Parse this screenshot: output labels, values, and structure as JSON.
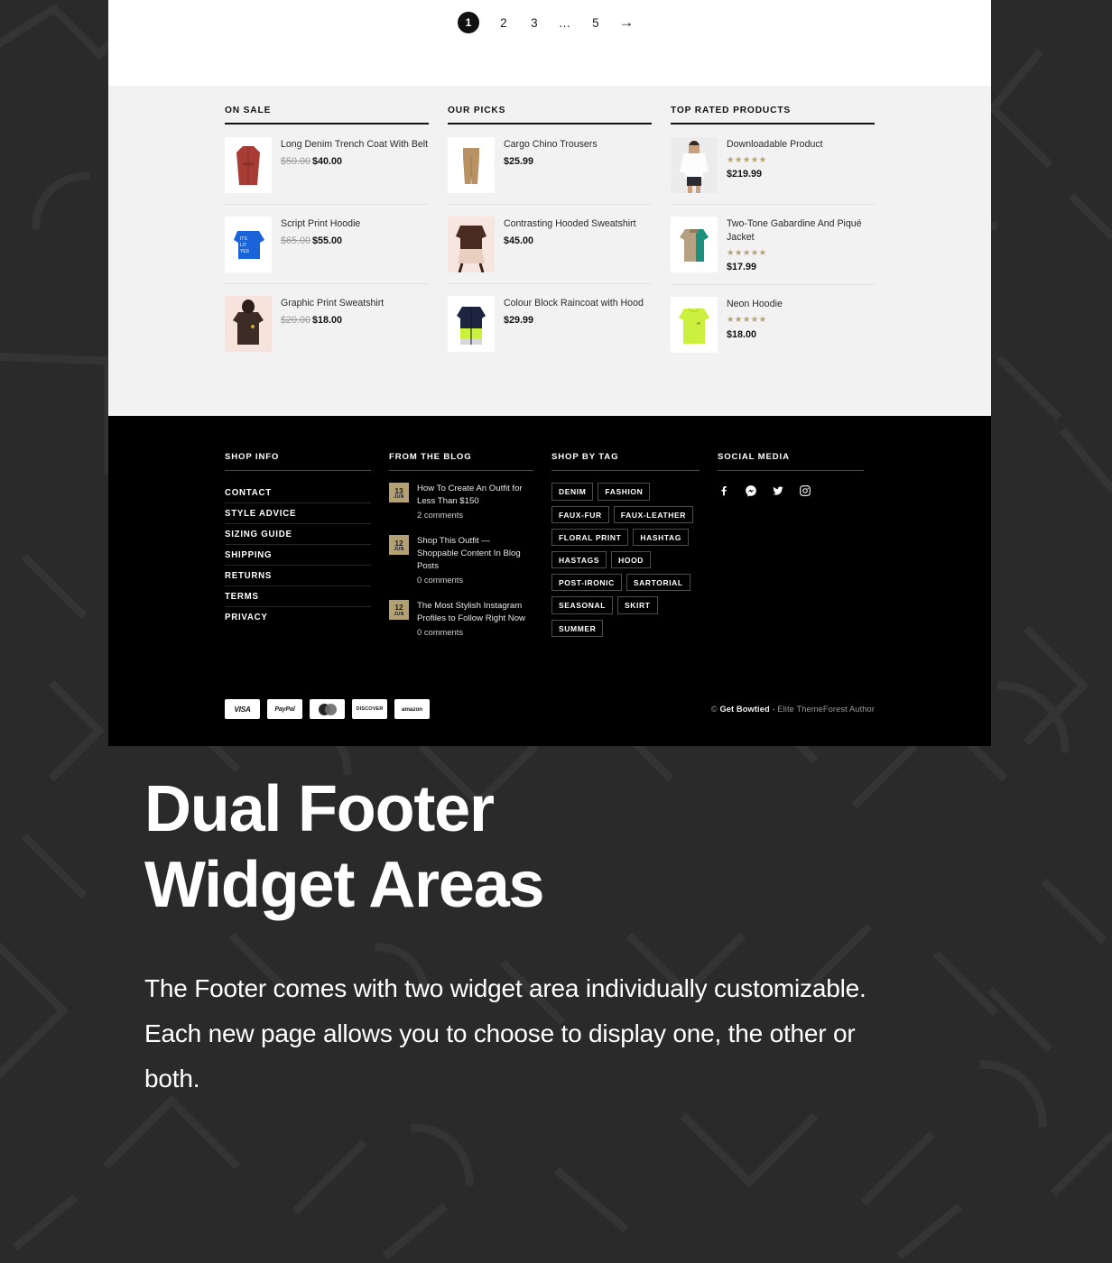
{
  "pagination": {
    "items": [
      {
        "label": "1",
        "active": true
      },
      {
        "label": "2",
        "active": false
      },
      {
        "label": "3",
        "active": false
      },
      {
        "label": "…",
        "active": false
      },
      {
        "label": "5",
        "active": false
      }
    ],
    "next_label": "→"
  },
  "widgets": [
    {
      "title": "ON SALE",
      "type": "sale",
      "products": [
        {
          "name": "Long Denim Trench Coat With Belt",
          "old_price": "$50.00",
          "price": "$40.00",
          "thumb": "trench-coat-red"
        },
        {
          "name": "Script Print Hoodie",
          "old_price": "$65.00",
          "price": "$55.00",
          "thumb": "hoodie-blue-print"
        },
        {
          "name": "Graphic Print Sweatshirt",
          "old_price": "$20.00",
          "price": "$18.00",
          "thumb": "sweatshirt-brown"
        }
      ]
    },
    {
      "title": "OUR PICKS",
      "type": "picks",
      "products": [
        {
          "name": "Cargo Chino Trousers",
          "price": "$25.99",
          "thumb": "chino-trousers-tan"
        },
        {
          "name": "Contrasting Hooded Sweatshirt",
          "price": "$45.00",
          "thumb": "hooded-sweatshirt-brown"
        },
        {
          "name": "Colour Block Raincoat with Hood",
          "price": "$29.99",
          "thumb": "raincoat-colourblock"
        }
      ]
    },
    {
      "title": "TOP RATED PRODUCTS",
      "type": "rated",
      "products": [
        {
          "name": "Downloadable Product",
          "rating": "★★★★★",
          "price": "$219.99",
          "thumb": "model-white-top"
        },
        {
          "name": "Two-Tone Gabardine And Piqué Jacket",
          "rating": "★★★★★",
          "price": "$17.99",
          "thumb": "jacket-two-tone"
        },
        {
          "name": "Neon Hoodie",
          "rating": "★★★★★",
          "price": "$18.00",
          "thumb": "hoodie-neon-green"
        }
      ]
    }
  ],
  "footer": {
    "shop_info": {
      "title": "SHOP INFO",
      "links": [
        "CONTACT",
        "STYLE ADVICE",
        "SIZING GUIDE",
        "SHIPPING",
        "RETURNS",
        "TERMS",
        "PRIVACY"
      ]
    },
    "blog": {
      "title": "FROM THE BLOG",
      "posts": [
        {
          "day": "13",
          "month": "JUN",
          "title": "How To Create An Outfit for Less Than $150",
          "comments": "2 comments"
        },
        {
          "day": "12",
          "month": "JUN",
          "title": "Shop This Outfit — Shoppable Content In Blog Posts",
          "comments": "0 comments"
        },
        {
          "day": "12",
          "month": "JUN",
          "title": "The Most Stylish Instagram Profiles to Follow Right Now",
          "comments": "0 comments"
        }
      ]
    },
    "tags": {
      "title": "SHOP BY TAG",
      "items": [
        "DENIM",
        "FASHION",
        "FAUX-FUR",
        "FAUX-LEATHER",
        "FLORAL PRINT",
        "HASHTAG",
        "HASTAGS",
        "HOOD",
        "POST-IRONIC",
        "SARTORIAL",
        "SEASONAL",
        "SKIRT",
        "SUMMER"
      ]
    },
    "social": {
      "title": "SOCIAL MEDIA",
      "icons": [
        "facebook-icon",
        "messenger-icon",
        "twitter-icon",
        "instagram-icon"
      ]
    },
    "payments": [
      "VISA",
      "PayPal",
      "mastercard",
      "DISCOVER",
      "amazon"
    ],
    "copyright_symbol": "© ",
    "copyright_brand": "Get Bowtied",
    "copyright_rest": " - Elite ThemeForest Author"
  },
  "hero": {
    "heading_line1": "Dual Footer",
    "heading_line2": "Widget Areas",
    "body": "The Footer comes with two widget area individually customizable. Each new page allows you to choose to display one, the other or both."
  },
  "colors": {
    "accent_tan": "#b4a173",
    "footer_bg": "#000000",
    "widget_bg": "#f2f2f2",
    "page_bg": "#2a2a2a"
  }
}
